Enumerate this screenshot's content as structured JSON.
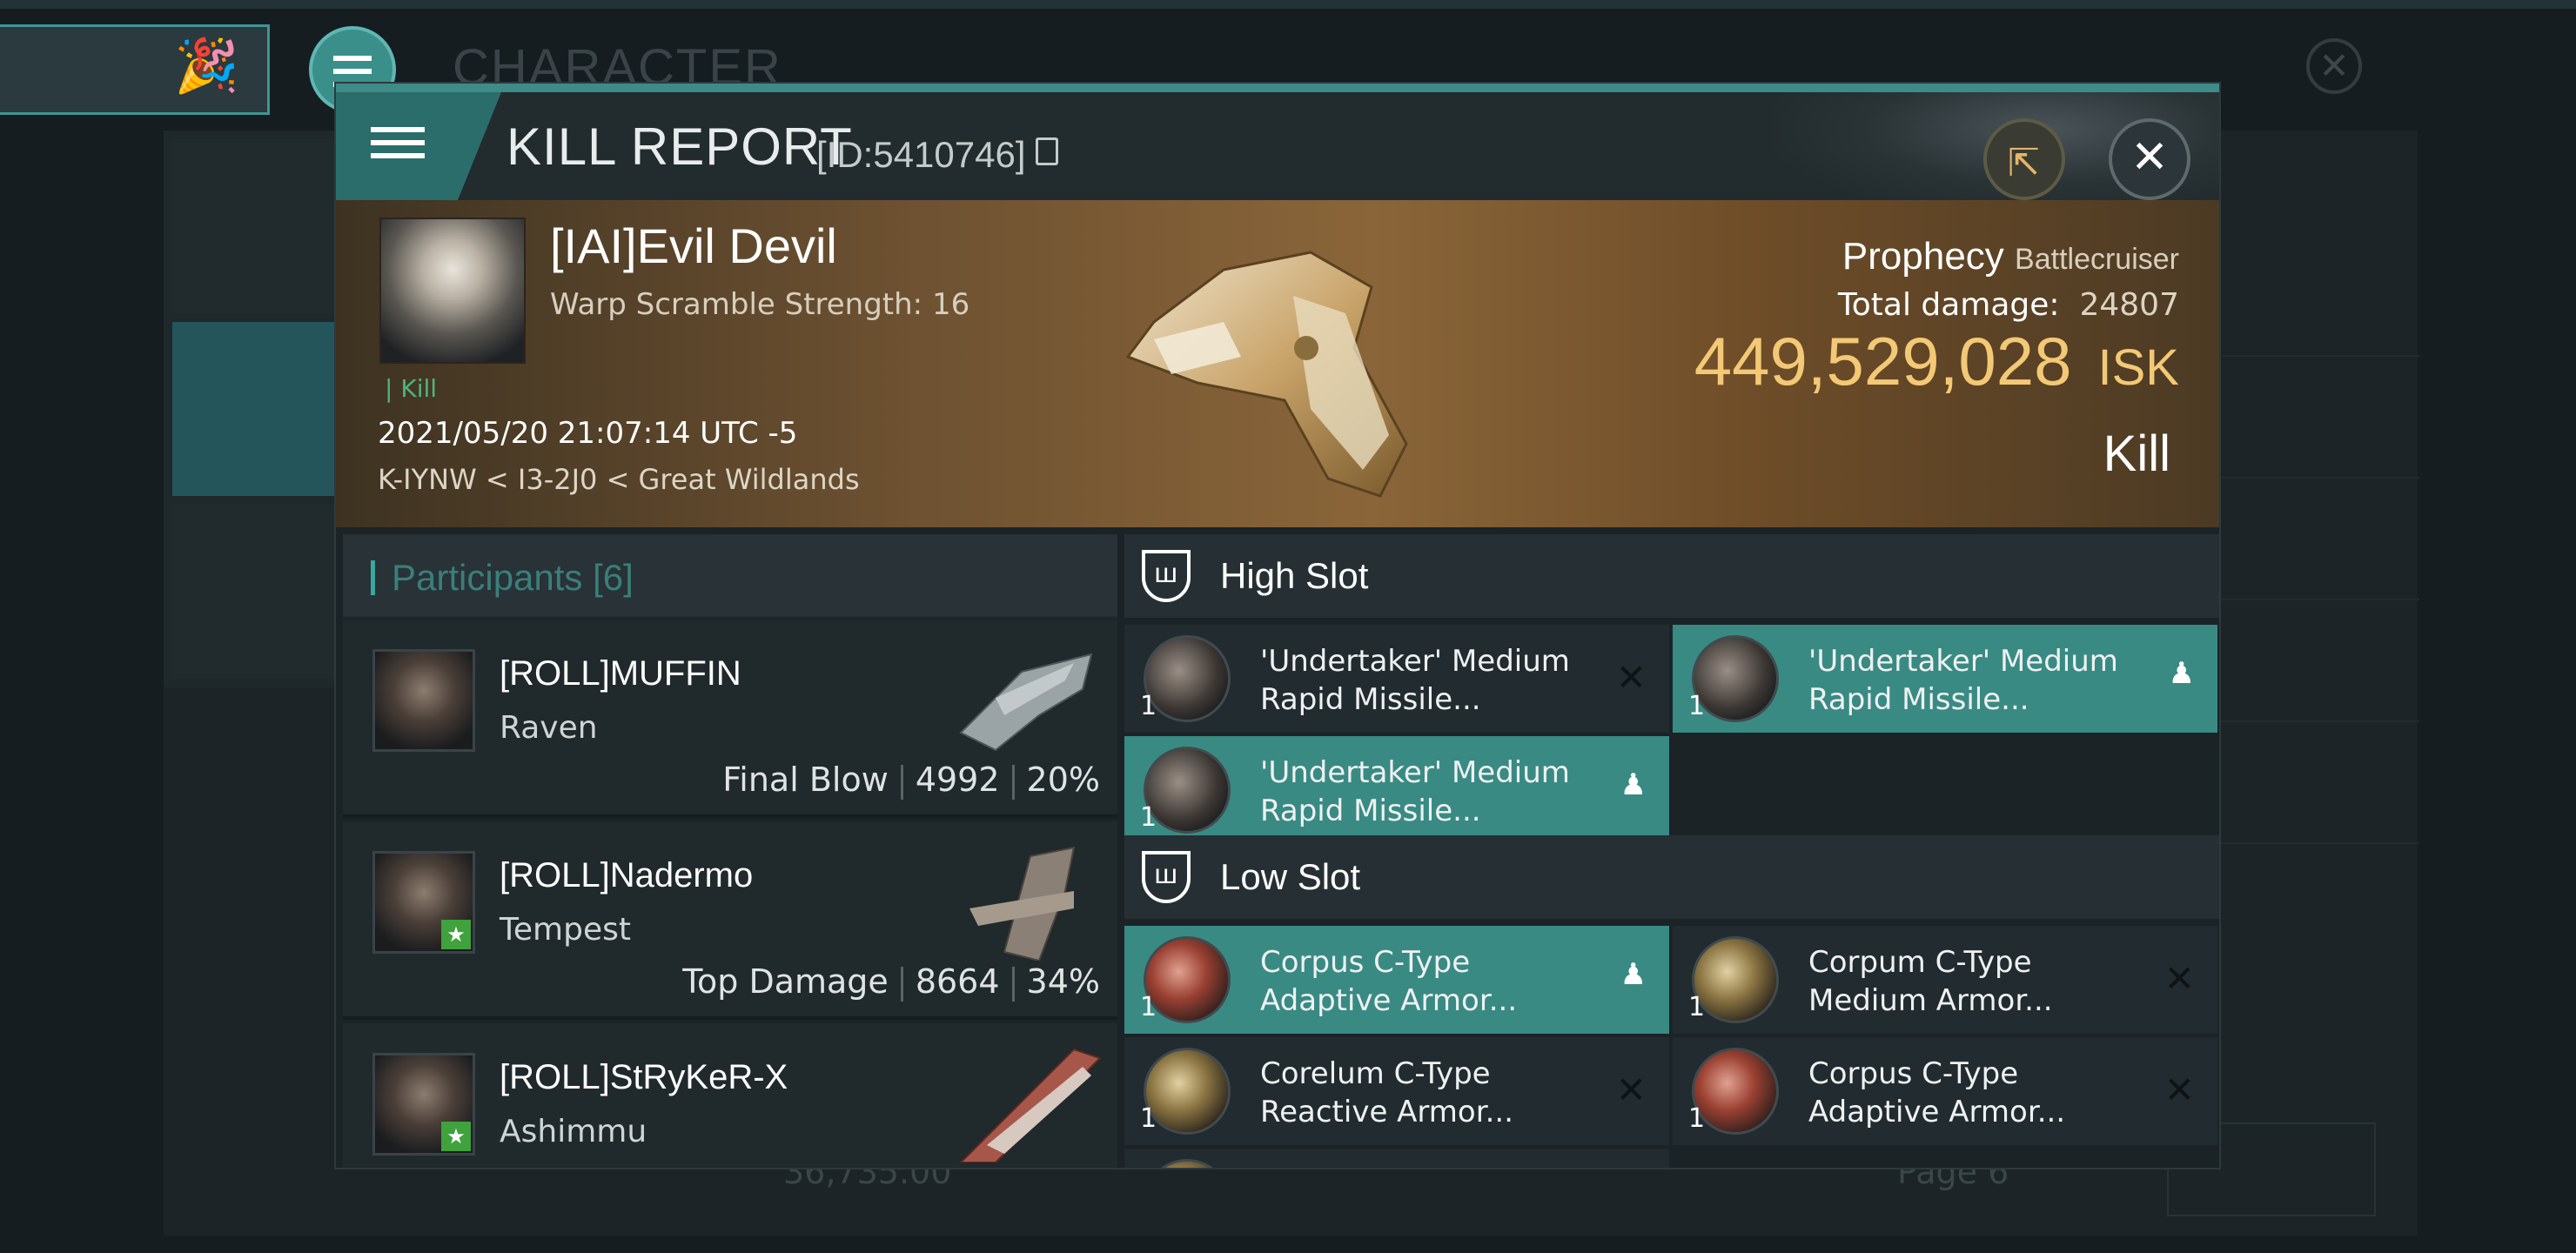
{
  "background": {
    "window_title": "CHARACTER",
    "amount": "36,735.00",
    "page_label": "Page 6"
  },
  "header": {
    "title": "KILL REPORT",
    "id_label": "[ID:5410746]",
    "share_icon": "share-icon",
    "close_icon": "close-icon"
  },
  "victim": {
    "name": "[IAI]Evil Devil",
    "warp_scramble": "Warp Scramble Strength: 16",
    "kill_tag": "Kill",
    "timestamp": "2021/05/20 21:07:14 UTC -5",
    "location": "K-IYNW < I3-2J0 < Great Wildlands",
    "ship_name": "Prophecy",
    "ship_class": "Battlecruiser",
    "total_damage_label": "Total damage:",
    "total_damage": "24807",
    "isk_value": "449,529,028",
    "isk_unit": "ISK",
    "result": "Kill"
  },
  "participants": {
    "title": "Participants",
    "count": "[6]",
    "list": [
      {
        "name": "[ROLL]MUFFIN",
        "ship": "Raven",
        "tag": "Final Blow",
        "damage": "4992",
        "percent": "20%",
        "star": false
      },
      {
        "name": "[ROLL]Nadermo",
        "ship": "Tempest",
        "tag": "Top Damage",
        "damage": "8664",
        "percent": "34%",
        "star": true
      },
      {
        "name": "[ROLL]StRyKeR-X",
        "ship": "Ashimmu",
        "tag": "",
        "damage": "",
        "percent": "",
        "star": true
      }
    ]
  },
  "fitting": {
    "high_slot_title": "High Slot",
    "low_slot_title": "Low Slot",
    "high_slot": [
      {
        "qty": "1",
        "name": "'Undertaker' Medium Rapid Missile...",
        "status": "destroyed"
      },
      {
        "qty": "1",
        "name": "'Undertaker' Medium Rapid Missile...",
        "status": "dropped"
      },
      {
        "qty": "1",
        "name": "'Undertaker' Medium Rapid Missile...",
        "status": "dropped"
      }
    ],
    "low_slot": [
      {
        "qty": "1",
        "name": "Corpus C-Type Adaptive Armor...",
        "status": "dropped"
      },
      {
        "qty": "1",
        "name": "Corpum C-Type Medium Armor...",
        "status": "destroyed"
      },
      {
        "qty": "1",
        "name": "Corelum C-Type Reactive Armor...",
        "status": "destroyed"
      },
      {
        "qty": "1",
        "name": "Corpus C-Type Adaptive Armor...",
        "status": "destroyed"
      }
    ]
  },
  "colors": {
    "accent": "#3a8a84",
    "isk": "#f3c876",
    "kill_green": "#4fb47d"
  }
}
